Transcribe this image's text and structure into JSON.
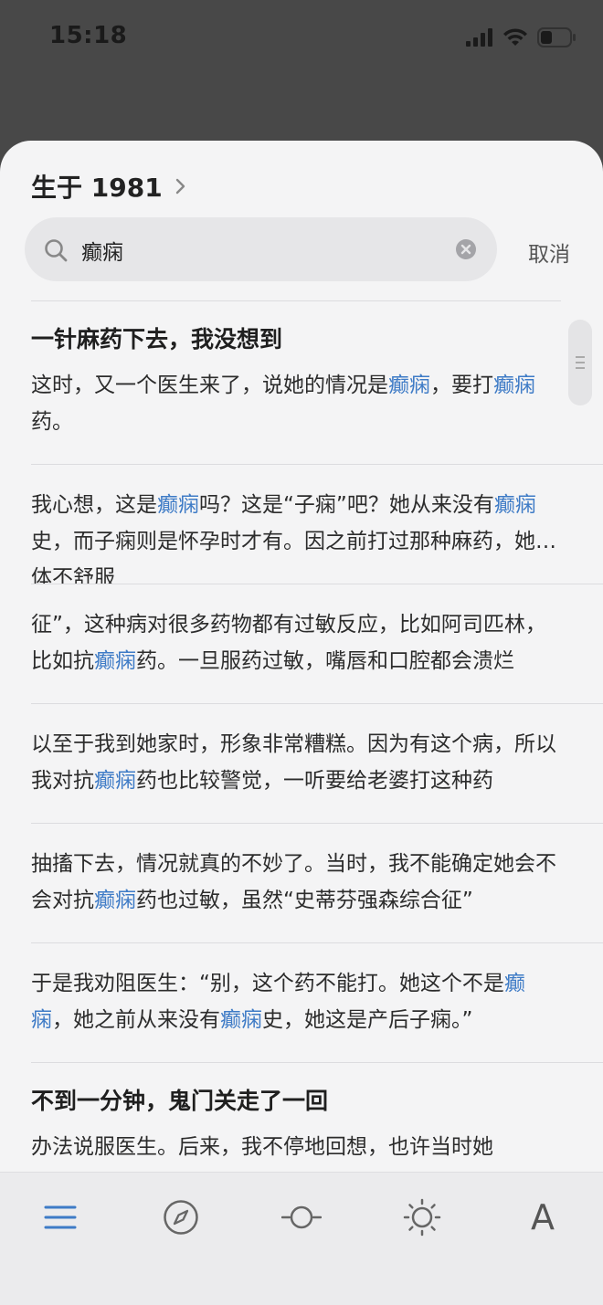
{
  "status_bar": {
    "time": "15:18"
  },
  "book": {
    "title": "生于 1981"
  },
  "search": {
    "query": "癫痫",
    "cancel_label": "取消"
  },
  "results": [
    {
      "heading": "一针麻药下去，我没想到",
      "segments": [
        {
          "text": "这时，又一个医生来了，说她的情况是",
          "hl": false
        },
        {
          "text": "癫痫",
          "hl": true
        },
        {
          "text": "，要打",
          "hl": false
        },
        {
          "text": "癫痫",
          "hl": true
        },
        {
          "text": "药。",
          "hl": false
        }
      ]
    },
    {
      "heading": "",
      "segments": [
        {
          "text": "我心想，这是",
          "hl": false
        },
        {
          "text": "癫痫",
          "hl": true
        },
        {
          "text": "吗？这是“子痫”吧？她从来没有",
          "hl": false
        },
        {
          "text": "癫痫",
          "hl": true
        },
        {
          "text": "史，而子痫则是怀孕时才有。因之前打过那种麻药，她身体不舒服",
          "hl": false
        }
      ]
    },
    {
      "heading": "",
      "segments": [
        {
          "text": "征”，这种病对很多药物都有过敏反应，比如阿司匹林，比如抗",
          "hl": false
        },
        {
          "text": "癫痫",
          "hl": true
        },
        {
          "text": "药。一旦服药过敏，嘴唇和口腔都会溃烂",
          "hl": false
        }
      ]
    },
    {
      "heading": "",
      "segments": [
        {
          "text": "以至于我到她家时，形象非常糟糕。因为有这个病，所以我对抗",
          "hl": false
        },
        {
          "text": "癫痫",
          "hl": true
        },
        {
          "text": "药也比较警觉，一听要给老婆打这种药",
          "hl": false
        }
      ]
    },
    {
      "heading": "",
      "segments": [
        {
          "text": "抽搐下去，情况就真的不妙了。当时，我不能确定她会不会对抗",
          "hl": false
        },
        {
          "text": "癫痫",
          "hl": true
        },
        {
          "text": "药也过敏，虽然“史蒂芬强森综合征”",
          "hl": false
        }
      ]
    },
    {
      "heading": "",
      "segments": [
        {
          "text": "于是我劝阻医生：“别，这个药不能打。她这个不是",
          "hl": false
        },
        {
          "text": "癫痫",
          "hl": true
        },
        {
          "text": "，她之前从来没有",
          "hl": false
        },
        {
          "text": "癫痫",
          "hl": true
        },
        {
          "text": "史，她这是产后子痫。”",
          "hl": false
        }
      ]
    },
    {
      "heading": "不到一分钟，鬼门关走了一回",
      "segments": [
        {
          "text": "办法说服医生。后来，我不停地回想，也许当时她",
          "hl": false
        }
      ]
    }
  ],
  "toolbar": {
    "font_label": "A"
  },
  "colors": {
    "highlight": "#3e7bc6",
    "toolbar_active": "#3e7bc6"
  }
}
